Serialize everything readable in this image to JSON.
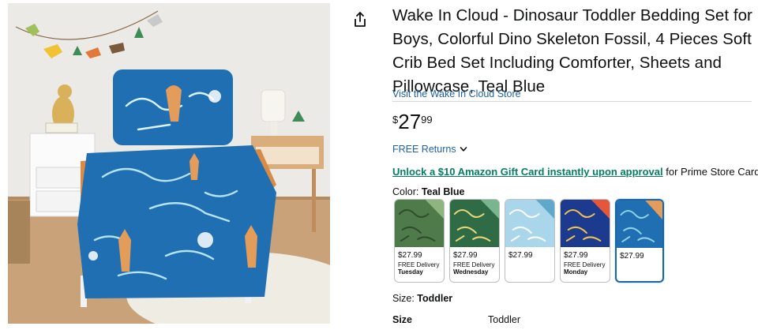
{
  "product": {
    "title": "Wake In Cloud - Dinosaur Toddler Bedding Set for Boys, Colorful Dino Skeleton Fossil, 4 Pieces Soft Crib Bed Set Including Comforter, Sheets and Pillowcase, Teal Blue",
    "store_link": "Visit the Wake In Cloud Store",
    "price": {
      "symbol": "$",
      "whole": "27",
      "fraction": "99"
    },
    "returns_label": "FREE Returns",
    "promo": {
      "link_text": "Unlock a $10 Amazon Gift Card instantly upon approval",
      "rest_text": " for Prime Store Card."
    },
    "color": {
      "label": "Color: ",
      "value": "Teal Blue"
    },
    "size": {
      "label": "Size: ",
      "value": "Toddler"
    },
    "spec": {
      "label": "Size",
      "value": "Toddler"
    },
    "image_icons": {
      "share": "share-icon",
      "returns_chevron": "chevron-down-icon"
    }
  },
  "swatches": [
    {
      "price": "$27.99",
      "shipping": "FREE Delivery",
      "day": "Tuesday",
      "selected": false,
      "colors": [
        "#4f7a4a",
        "#8fb57e",
        "#2f4d2d"
      ]
    },
    {
      "price": "$27.99",
      "shipping": "FREE Delivery",
      "day": "Wednesday",
      "selected": false,
      "colors": [
        "#2f6b44",
        "#79b58d",
        "#e9d67a"
      ]
    },
    {
      "price": "$27.99",
      "shipping": "",
      "day": "",
      "selected": false,
      "colors": [
        "#a9d6ea",
        "#5fa8cc",
        "#ffffff"
      ]
    },
    {
      "price": "$27.99",
      "shipping": "FREE Delivery",
      "day": "Monday",
      "selected": false,
      "colors": [
        "#1c3a8e",
        "#e5573b",
        "#f2c14e"
      ]
    },
    {
      "price": "$27.99",
      "shipping": "",
      "day": "",
      "selected": true,
      "colors": [
        "#1f6fb2",
        "#e39c5a",
        "#8fd3e8"
      ]
    }
  ],
  "theme": {
    "link": "#2162a1",
    "promo_green": "#067d62",
    "selected_border": "#2162a1"
  }
}
